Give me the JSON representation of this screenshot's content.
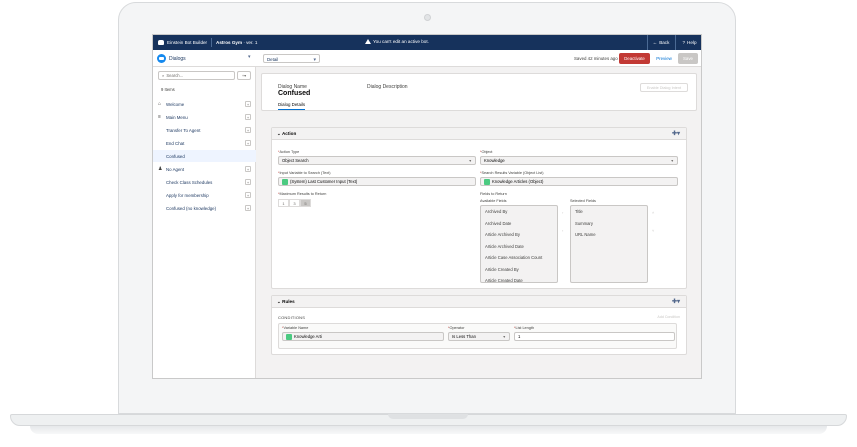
{
  "topbar": {
    "app_name": "Einstein Bot Builder",
    "bot_name": "Astros Gym",
    "bot_version": "· ver. 1",
    "warning": "You can't edit an active bot.",
    "back_label": "Back",
    "help_label": "Help"
  },
  "subbar": {
    "dialogs_label": "Dialogs",
    "view_select": "Detail",
    "saved_status": "Saved 42 minutes ago",
    "deactivate_label": "Deactivate",
    "preview_label": "Preview",
    "save_label": "Save"
  },
  "sidebar": {
    "search_placeholder": "Search...",
    "items_count": "9 Items",
    "items": [
      {
        "label": "Welcome",
        "icon": "home-icon"
      },
      {
        "label": "Main Menu",
        "icon": "menu-icon"
      },
      {
        "label": "Transfer To Agent"
      },
      {
        "label": "End Chat"
      },
      {
        "label": "Confused"
      },
      {
        "label": "No Agent",
        "icon": "agent-icon"
      },
      {
        "label": "Check Class Schedules"
      },
      {
        "label": "Apply for membership"
      },
      {
        "label": "Confused (no knowledge)"
      }
    ]
  },
  "dialog": {
    "name_label": "Dialog Name",
    "name": "Confused",
    "description_label": "Dialog Description",
    "enable_button": "Enable Dialog Intent",
    "tab": "Dialog Details"
  },
  "action": {
    "section_title": "Action",
    "action_type_label": "Action Type",
    "action_type_value": "Object Search",
    "object_label": "Object",
    "object_value": "Knowledge",
    "input_var_label": "Input Variable to Search (Text)",
    "input_var_value": "(System) Last Customer Input (Text)",
    "results_var_label": "Search Results Variable (Object List)",
    "results_var_value": "Knowledge Articles (Object)",
    "max_results_label": "Maximum Results to Return",
    "max_results_options": [
      "1",
      "3",
      "5"
    ],
    "fields_label": "Fields to Return",
    "available_label": "Available Fields",
    "selected_label": "Selected Fields",
    "available_fields": [
      "Archived By",
      "Archived Date",
      "Article Archived By",
      "Article Archived Date",
      "Article Case Association Count",
      "Article Created By",
      "Article Created Date"
    ],
    "selected_fields": [
      "Title",
      "Summary",
      "URL Name"
    ]
  },
  "rules": {
    "section_title": "Rules",
    "conditions_label": "CONDITIONS",
    "conditions_right": "Add Condition",
    "variable_label": "Variable Name",
    "variable_value": "Knowledge Arti",
    "operator_label": "Operator",
    "operator_value": "Is Less Than",
    "list_length_label": "List Length",
    "list_length_value": "1"
  },
  "colors": {
    "topbar": "#16325c",
    "accent": "#0070d2",
    "deactivate": "#c23934",
    "pill": "#4bca81"
  }
}
